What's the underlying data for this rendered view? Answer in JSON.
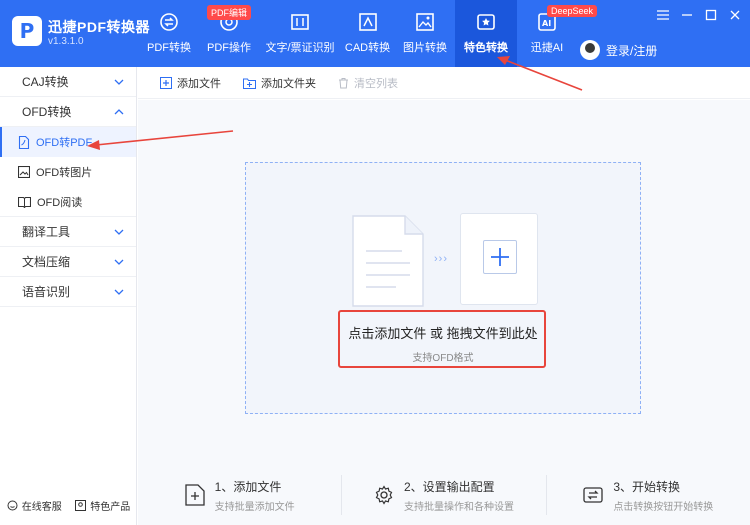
{
  "app": {
    "logo_letter": "P",
    "name": "迅捷PDF转换器",
    "version": "v1.3.1.0"
  },
  "nav": [
    {
      "label": "PDF转换",
      "icon": "pdf-convert-icon",
      "badge": ""
    },
    {
      "label": "PDF操作",
      "icon": "pdf-operate-icon",
      "badge": "PDF编辑"
    },
    {
      "label": "文字/票证识别",
      "icon": "ocr-icon",
      "badge": ""
    },
    {
      "label": "CAD转换",
      "icon": "cad-icon",
      "badge": ""
    },
    {
      "label": "图片转换",
      "icon": "image-icon",
      "badge": ""
    },
    {
      "label": "特色转换",
      "icon": "special-convert-icon",
      "badge": "",
      "active": true
    },
    {
      "label": "迅捷AI",
      "icon": "ai-icon",
      "badge": "DeepSeek"
    }
  ],
  "user": {
    "label": "登录/注册"
  },
  "window_controls": [
    "menu",
    "minimize",
    "maximize",
    "close"
  ],
  "sidebar": {
    "groups": [
      {
        "label": "CAJ转换",
        "expanded": false
      },
      {
        "label": "OFD转换",
        "expanded": true
      },
      {
        "label": "翻译工具",
        "expanded": false
      },
      {
        "label": "文档压缩",
        "expanded": false
      },
      {
        "label": "语音识别",
        "expanded": false
      }
    ],
    "ofd_items": [
      {
        "label": "OFD转PDF",
        "icon": "pdf-file-icon",
        "active": true
      },
      {
        "label": "OFD转图片",
        "icon": "image-file-icon",
        "active": false
      },
      {
        "label": "OFD阅读",
        "icon": "book-icon",
        "active": false
      }
    ],
    "footer": {
      "service": "在线客服",
      "products": "特色产品"
    }
  },
  "toolbar": {
    "add_file": "添加文件",
    "add_folder": "添加文件夹",
    "clear_list": "清空列表"
  },
  "dropzone": {
    "title": "点击添加文件 或 拖拽文件到此处",
    "subtitle": "支持OFD格式"
  },
  "steps": [
    {
      "title": "1、添加文件",
      "subtitle": "支持批量添加文件",
      "icon": "add-file-icon"
    },
    {
      "title": "2、设置输出配置",
      "subtitle": "支持批量操作和各种设置",
      "icon": "gear-icon"
    },
    {
      "title": "3、开始转换",
      "subtitle": "点击转换按钮开始转换",
      "icon": "convert-icon"
    }
  ],
  "colors": {
    "brand": "#2f6ff3",
    "brand_dark": "#1b57dc",
    "annotation": "#e8453c",
    "badge": "#ff4a4a"
  }
}
